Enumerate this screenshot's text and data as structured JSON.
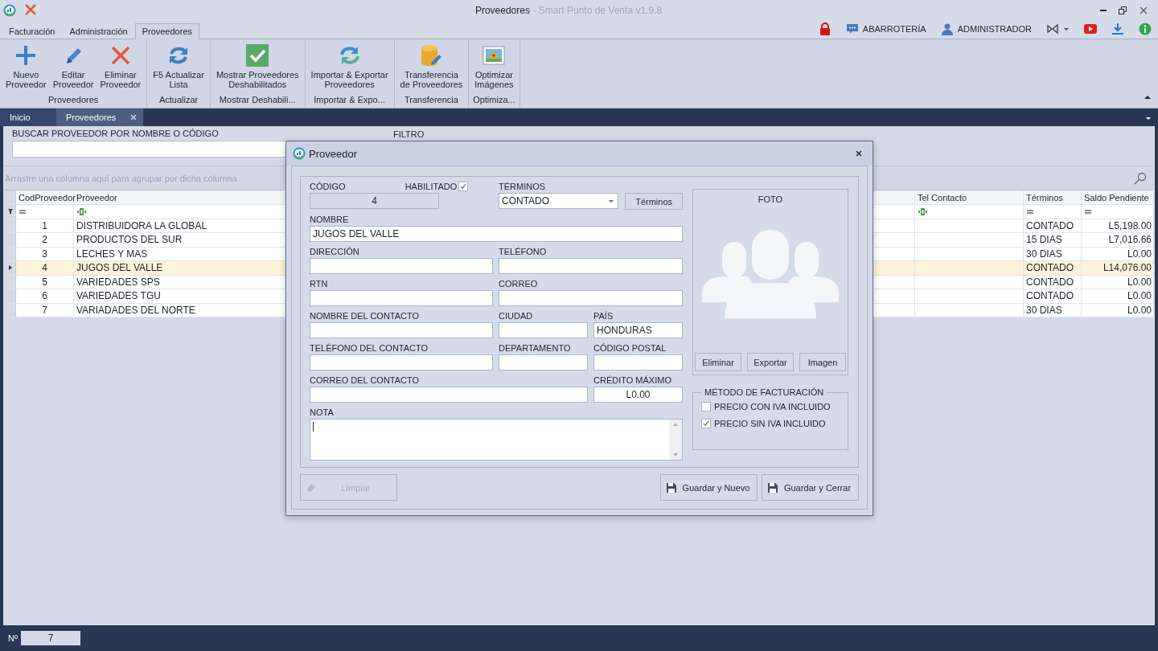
{
  "window": {
    "title": "Proveedores",
    "subtitle": "- Smart Punto de Venta v1.9.8"
  },
  "menu_tabs": [
    {
      "label": "Facturación",
      "selected": false
    },
    {
      "label": "Administración",
      "selected": false
    },
    {
      "label": "Proveedores",
      "selected": true
    }
  ],
  "account": {
    "store": "ABARROTERÍA",
    "user": "ADMINISTRADOR"
  },
  "ribbon": [
    {
      "label": "Proveedores",
      "buttons": [
        "Nuevo\nProveedor",
        "Editar\nProveedor",
        "Eliminar\nProveedor"
      ]
    },
    {
      "label": "Actualizar",
      "buttons": [
        "F5 Actualizar\nLista"
      ]
    },
    {
      "label": "Mostrar Deshabili...",
      "buttons": [
        "Mostrar Proveedores\nDeshabilitados"
      ]
    },
    {
      "label": "Importar & Expo...",
      "buttons": [
        "Importar & Exportar\nProveedores"
      ]
    },
    {
      "label": "Transferencia",
      "buttons": [
        "Transferencia\nde Proveedores"
      ]
    },
    {
      "label": "Optimiza...",
      "buttons": [
        "Optimizar\nImágenes"
      ]
    }
  ],
  "doc_tabs": [
    {
      "label": "Inicio",
      "selected": false,
      "closable": false
    },
    {
      "label": "Proveedores",
      "selected": true,
      "closable": true
    }
  ],
  "search": {
    "label": "BUSCAR PROVEEDOR POR NOMBRE O CÓDIGO",
    "filter_label": "FILTRO"
  },
  "table": {
    "group_hint": "Arrastre una columna aquí para agrupar por dicha columna",
    "columns": [
      {
        "label": "CodProveedor",
        "kind": "equals"
      },
      {
        "label": "Proveedor",
        "kind": "text"
      },
      {
        "label": "Tel Contacto",
        "kind": "text"
      },
      {
        "label": "Términos",
        "kind": "equals"
      },
      {
        "label": "Saldo Pendiente",
        "kind": "equals"
      }
    ],
    "rows": [
      {
        "code": "1",
        "name": "DISTRIBUIDORA LA GLOBAL",
        "terms": "CONTADO",
        "balance": "L5,198.00",
        "selected": false
      },
      {
        "code": "2",
        "name": "PRODUCTOS DEL SUR",
        "terms": "15 DIAS",
        "balance": "L7,016.66",
        "selected": false
      },
      {
        "code": "3",
        "name": "LECHES Y MAS",
        "terms": "30 DIAS",
        "balance": "L0.00",
        "selected": false
      },
      {
        "code": "4",
        "name": "JUGOS DEL VALLE",
        "terms": "CONTADO",
        "balance": "L14,076.00",
        "selected": true
      },
      {
        "code": "5",
        "name": "VARIEDADES SPS",
        "terms": "CONTADO",
        "balance": "L0.00",
        "selected": false
      },
      {
        "code": "6",
        "name": "VARIEDADES TGU",
        "terms": "CONTADO",
        "balance": "L0.00",
        "selected": false
      },
      {
        "code": "7",
        "name": "VARIADADES DEL NORTE",
        "terms": "30 DIAS",
        "balance": "L0.00",
        "selected": false
      }
    ]
  },
  "dialog": {
    "title": "Proveedor",
    "form": {
      "code": {
        "label": "CÓDIGO",
        "value": "4"
      },
      "enabled": {
        "label": "HABILITADO",
        "checked": true
      },
      "terms": {
        "label": "TÉRMINOS",
        "value": "CONTADO",
        "button": "Términos"
      },
      "name": {
        "label": "NOMBRE",
        "value": "JUGOS DEL VALLE"
      },
      "address": {
        "label": "DIRECCIÓN"
      },
      "phone": {
        "label": "TELÉFONO"
      },
      "rtn": {
        "label": "RTN"
      },
      "email": {
        "label": "CORREO"
      },
      "contact_name": {
        "label": "NOMBRE DEL CONTACTO"
      },
      "city": {
        "label": "CIUDAD"
      },
      "country": {
        "label": "PAÍS",
        "value": "HONDURAS"
      },
      "contact_phone": {
        "label": "TELÉFONO DEL CONTACTO"
      },
      "department": {
        "label": "DEPARTAMENTO"
      },
      "postal_code": {
        "label": "CÓDIGO POSTAL"
      },
      "contact_email": {
        "label": "CORREO DEL CONTACTO"
      },
      "max_credit": {
        "label": "CRÉDITO MÁXIMO",
        "value": "L0.00"
      },
      "note": {
        "label": "NOTA"
      }
    },
    "photo": {
      "label": "FOTO",
      "buttons": [
        "Eliminar",
        "Exportar",
        "Imagen"
      ]
    },
    "billing": {
      "title": "MÉTODO DE FACTURACIÓN",
      "options": [
        {
          "label": "PRECIO CON IVA INCLUIDO",
          "checked": false
        },
        {
          "label": "PRECIO SIN IVA INCLUIDO",
          "checked": true
        }
      ]
    },
    "footer": [
      {
        "label": "Limpiar",
        "kind": "clear",
        "disabled": true
      },
      {
        "label": "Guardar y Nuevo",
        "kind": "save",
        "disabled": false
      },
      {
        "label": "Guardar y Cerrar",
        "kind": "save",
        "disabled": false
      }
    ]
  },
  "status_bar": {
    "label": "Nº",
    "value": "7"
  }
}
